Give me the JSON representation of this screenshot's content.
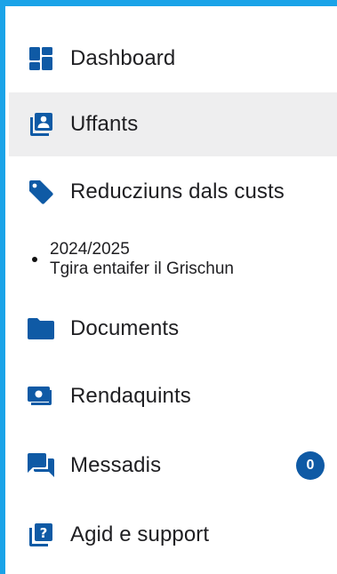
{
  "colors": {
    "accent": "#0f5aa5",
    "frame": "#1aa3e8",
    "active_background": "#eeeeef"
  },
  "nav": {
    "items": [
      {
        "label": "Dashboard",
        "icon": "dashboard-icon"
      },
      {
        "label": "Uffants",
        "icon": "children-icon",
        "active": true
      },
      {
        "label": "Reducziuns dals custs",
        "icon": "tag-icon"
      },
      {
        "year": "2024/2025",
        "subtitle": "Tgira entaifer il Grischun"
      },
      {
        "label": "Documents",
        "icon": "folder-icon"
      },
      {
        "label": "Rendaquints",
        "icon": "invoice-icon"
      },
      {
        "label": "Messadis",
        "icon": "messages-icon",
        "badge": "0"
      },
      {
        "label": "Agid e support",
        "icon": "help-icon"
      }
    ]
  }
}
